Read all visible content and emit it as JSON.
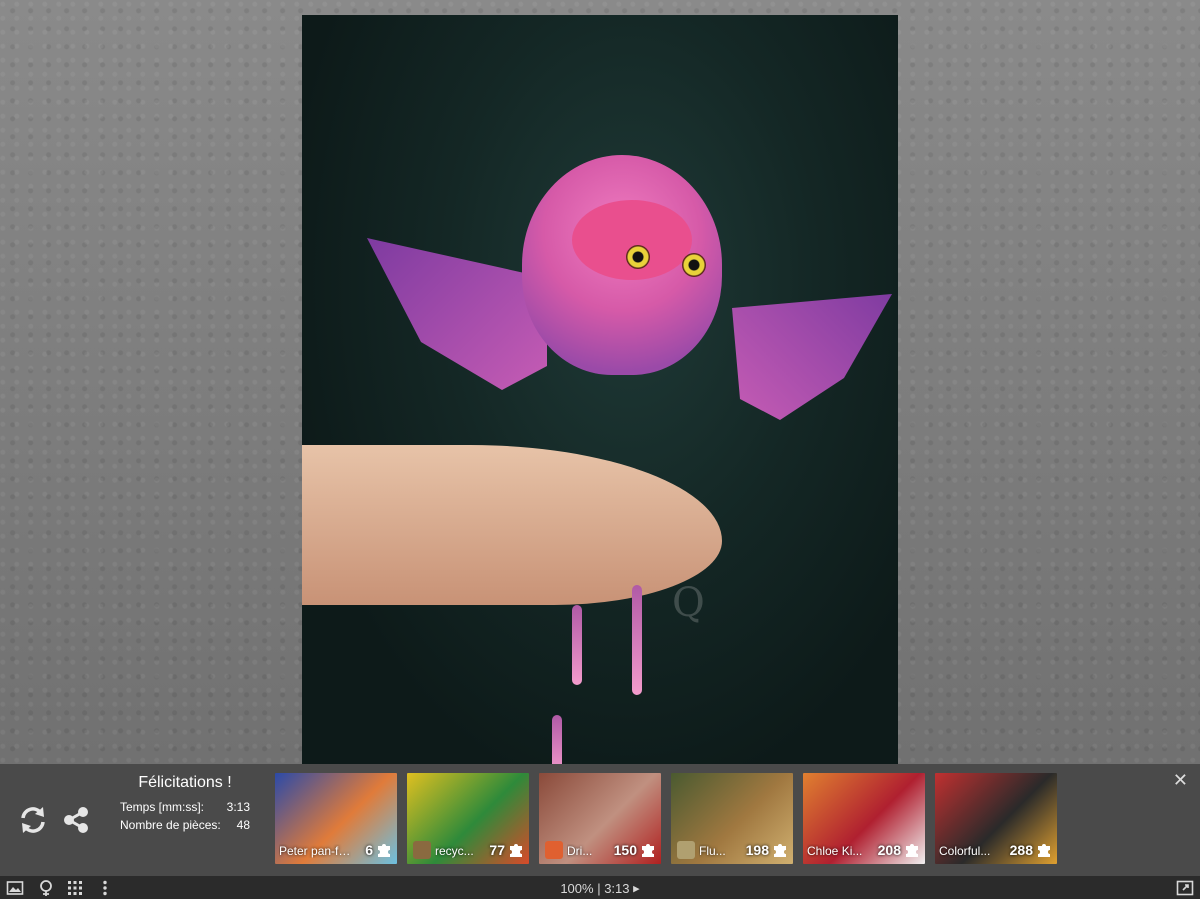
{
  "board": {
    "watermark_text": "Q",
    "image_subject": "pink owl puppet on hand"
  },
  "result": {
    "title": "Félicitations !",
    "time_label": "Temps [mm:ss]:",
    "time_value": "3:13",
    "pieces_label": "Nombre de pièces:",
    "pieces_value": "48"
  },
  "actions": {
    "restart_icon": "refresh-icon",
    "share_icon": "share-icon"
  },
  "suggestions": [
    {
      "label": "Peter pan-fl...",
      "count": "6",
      "colors": [
        "#2b4aa8",
        "#e07b3a",
        "#6cc0e0"
      ]
    },
    {
      "label": "recyc...",
      "count": "77",
      "colors": [
        "#e0c020",
        "#2e8a3a",
        "#d84a2a"
      ]
    },
    {
      "label": "Dri...",
      "count": "150",
      "colors": [
        "#8a4a3a",
        "#c09080",
        "#b02020"
      ]
    },
    {
      "label": "Flu...",
      "count": "198",
      "colors": [
        "#4a5a30",
        "#a07840",
        "#d0b070"
      ]
    },
    {
      "label": "Chloe Ki...",
      "count": "208",
      "colors": [
        "#e08030",
        "#b02030",
        "#f0f0f0"
      ]
    },
    {
      "label": "Colorful...",
      "count": "288",
      "colors": [
        "#c03030",
        "#2a2a2a",
        "#e0a030"
      ]
    }
  ],
  "close_label": "✕",
  "status": {
    "zoom": "100%",
    "separator": "|",
    "timer": "3:13",
    "play_symbol": "▸"
  },
  "colors": {
    "panel_bg": "#4a4a4a",
    "status_bg": "#2b2b2b"
  }
}
